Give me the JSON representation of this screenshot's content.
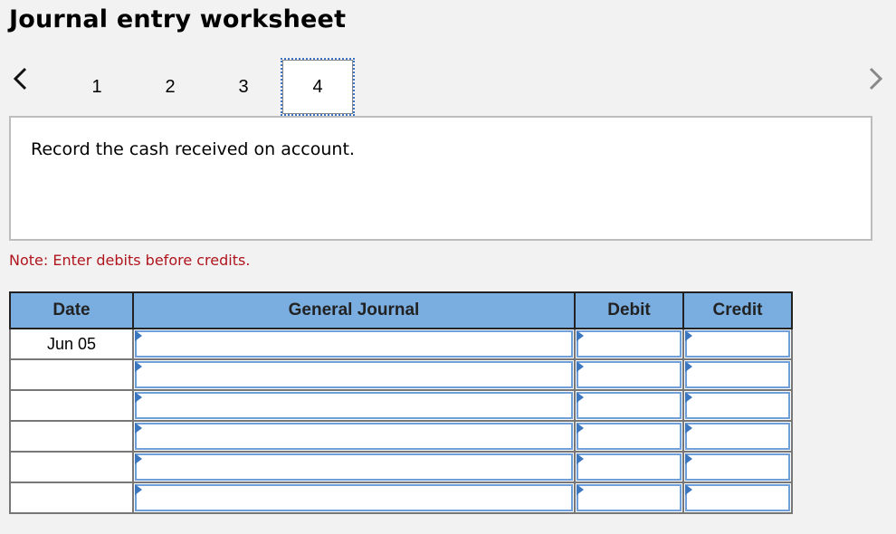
{
  "header": {
    "title": "Journal entry worksheet"
  },
  "navigation": {
    "prev_icon": "chevron-left-icon",
    "next_icon": "chevron-right-icon",
    "tabs": [
      {
        "label": "1",
        "active": false
      },
      {
        "label": "2",
        "active": false
      },
      {
        "label": "3",
        "active": false
      },
      {
        "label": "4",
        "active": true
      }
    ]
  },
  "prompt": {
    "text": "Record the cash received on account."
  },
  "note": {
    "text": "Note: Enter debits before credits.",
    "color": "#b0151d"
  },
  "journal": {
    "columns": [
      "Date",
      "General Journal",
      "Debit",
      "Credit"
    ],
    "header_color": "#7aaee1",
    "rows": [
      {
        "date": "Jun 05",
        "account": "",
        "debit": "",
        "credit": ""
      },
      {
        "date": "",
        "account": "",
        "debit": "",
        "credit": ""
      },
      {
        "date": "",
        "account": "",
        "debit": "",
        "credit": ""
      },
      {
        "date": "",
        "account": "",
        "debit": "",
        "credit": ""
      },
      {
        "date": "",
        "account": "",
        "debit": "",
        "credit": ""
      },
      {
        "date": "",
        "account": "",
        "debit": "",
        "credit": ""
      }
    ]
  }
}
